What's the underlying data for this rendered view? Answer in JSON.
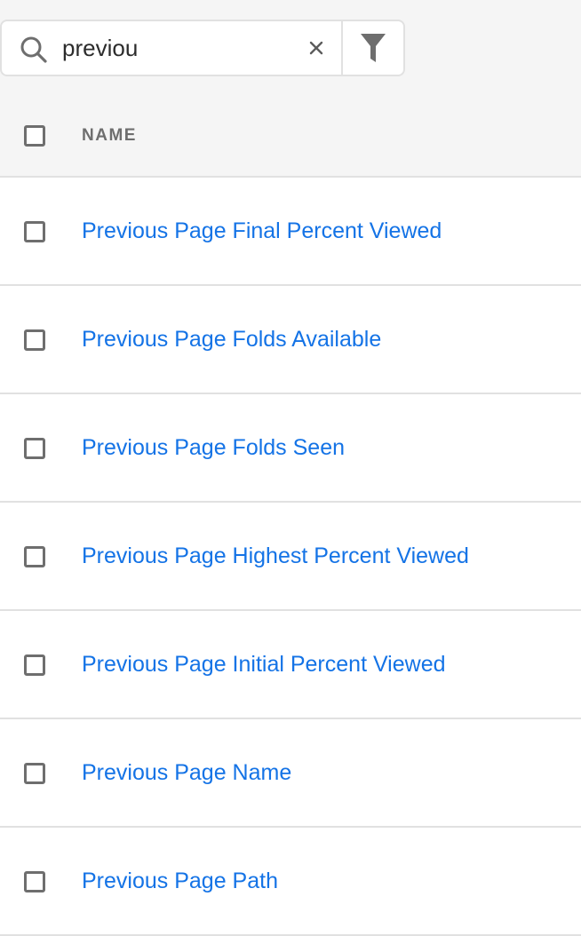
{
  "search": {
    "value": "previou",
    "clear_icon": "close-icon",
    "search_icon": "search-icon",
    "filter_icon": "filter-icon"
  },
  "table": {
    "header": {
      "name": "NAME"
    },
    "rows": [
      {
        "label": "Previous Page Final Percent Viewed"
      },
      {
        "label": "Previous Page Folds Available"
      },
      {
        "label": "Previous Page Folds Seen"
      },
      {
        "label": "Previous Page Highest Percent Viewed"
      },
      {
        "label": "Previous Page Initial Percent Viewed"
      },
      {
        "label": "Previous Page Name"
      },
      {
        "label": "Previous Page Path"
      }
    ]
  },
  "colors": {
    "link": "#1473e6",
    "header_text": "#6e6e6e",
    "background_top": "#f5f5f5",
    "divider": "#e1e1e1"
  }
}
